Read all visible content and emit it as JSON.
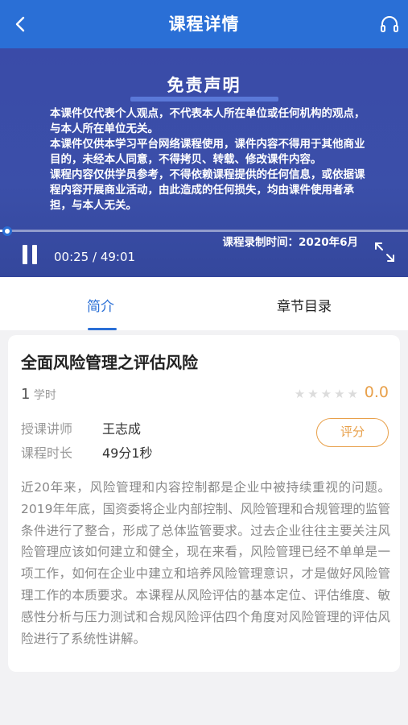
{
  "header": {
    "title": "课程详情",
    "back_icon": "chevron-left-icon",
    "headset_icon": "headset-icon",
    "background": "#2a6fd6"
  },
  "video": {
    "disclaimer_title": "免责声明",
    "disclaimer_lines": [
      "本课件仅代表个人观点，不代表本人所在单位或任何机构的观点，与本人所在单位无关。",
      "本课件仅供本学习平台网络课程使用，课件内容不得用于其他商业目的，未经本人同意，不得拷贝、转载、修改课件内容。",
      "课程内容仅供学员参考，不得依赖课程提供的任何信息，或依据课程内容开展商业活动，由此造成的任何损失，均由课件使用者承担，与本人无关。"
    ],
    "record_time": "课程录制时间：2020年6月",
    "current_time": "00:25",
    "separator": " / ",
    "total_time": "49:01",
    "progress_fraction": 0.0085,
    "pause_icon": "pause-icon",
    "fullscreen_icon": "fullscreen-icon"
  },
  "tabs": {
    "intro": "简介",
    "chapters": "章节目录",
    "active": "intro",
    "active_color": "#2a6fd6"
  },
  "course": {
    "title": "全面风险管理之评估风险",
    "hours_value": "1",
    "hours_unit": "学时",
    "star_count": 5,
    "stars_filled": 0,
    "rating": "0.0",
    "teacher_label": "授课讲师",
    "teacher": "王志成",
    "duration_label": "课程时长",
    "duration": "49分1秒",
    "rate_button": "评分",
    "accent_color": "#e8a04a",
    "description": "近20年来，风险管理和内容控制都是企业中被持续重视的问题。2019年年底，国资委将企业内部控制、风险管理和合规管理的监管条件进行了整合，形成了总体监管要求。过去企业往往主要关注风险管理应该如何建立和健全，现在来看，风险管理已经不单单是一项工作，如何在企业中建立和培养风险管理意识，才是做好风险管理工作的本质要求。本课程从风险评估的基本定位、评估维度、敏感性分析与压力测试和合规风险评估四个角度对风险管理的评估风险进行了系统性讲解。"
  }
}
